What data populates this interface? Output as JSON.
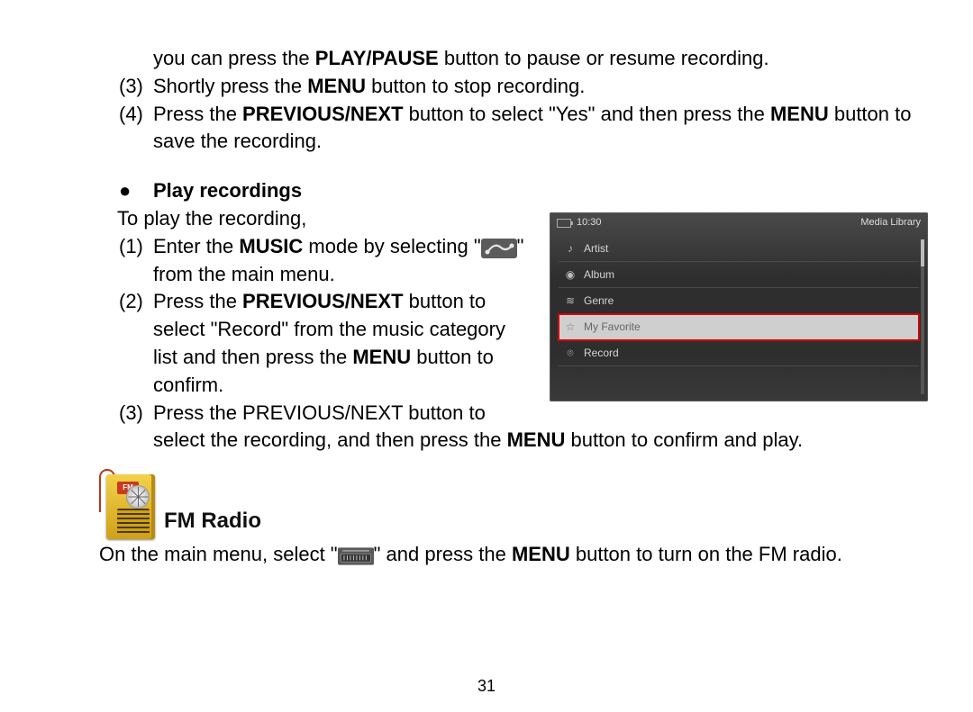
{
  "top": {
    "line_cont": {
      "prefix": "you can press the ",
      "bold": "PLAY/PAUSE",
      "suffix": " button to pause or resume recording."
    },
    "item3": {
      "num": "(3)",
      "prefix": "Shortly press the ",
      "bold": "MENU",
      "suffix": " button to stop recording."
    },
    "item4": {
      "num": "(4)",
      "t1": "Press the ",
      "b1": "PREVIOUS/NEXT",
      "t2": " button to select \"Yes\" and then press the ",
      "b2": "MENU",
      "t3": " button to save the recording."
    }
  },
  "play": {
    "bullet": "●",
    "heading": "Play recordings",
    "intro": "To play the recording,",
    "item1": {
      "num": "(1)",
      "t1": "Enter the ",
      "b1": "MUSIC",
      "t2": " mode by selecting \"",
      "t3": "\" from the main menu."
    },
    "item2": {
      "num": "(2)",
      "t1": "Press the ",
      "b1": "PREVIOUS/NEXT",
      "t2": " button to select \"Record\" from the music category list and then press the ",
      "b2": "MENU",
      "t3": " button to confirm."
    },
    "item3": {
      "num": "(3)",
      "t1": "Press the PREVIOUS/NEXT button to select the recording, and then press the ",
      "b1": "MENU",
      "t2": " button to confirm and play."
    }
  },
  "device": {
    "time": "10:30",
    "title": "Media Library",
    "rows": [
      {
        "icon": "artist-icon",
        "glyph": "♪",
        "label": "Artist",
        "selected": false
      },
      {
        "icon": "album-icon",
        "glyph": "◉",
        "label": "Album",
        "selected": false
      },
      {
        "icon": "genre-icon",
        "glyph": "≋",
        "label": "Genre",
        "selected": false
      },
      {
        "icon": "favorite-icon",
        "glyph": "☆",
        "label": "My Favorite",
        "selected": true
      },
      {
        "icon": "record-icon",
        "glyph": "⌾",
        "label": "Record",
        "selected": false
      }
    ]
  },
  "fm": {
    "badge": "FM",
    "heading": "FM Radio",
    "line": {
      "t1": "On the main menu, select \"",
      "t2": "\" and press the ",
      "b1": "MENU",
      "t3": " button to turn on the FM radio."
    }
  },
  "page_number": "31"
}
